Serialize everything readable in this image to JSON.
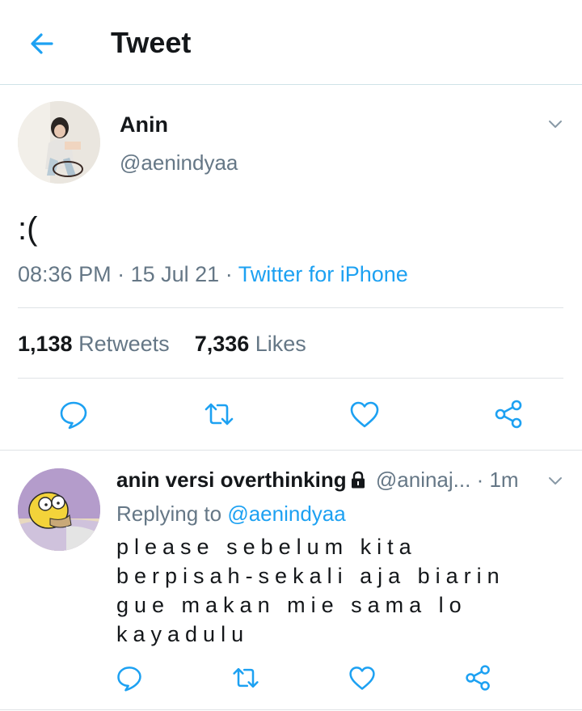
{
  "header": {
    "title": "Tweet",
    "back_icon": "arrow-left-icon"
  },
  "tweet": {
    "author": {
      "name": "Anin",
      "handle": "@aenindyaa"
    },
    "text": ":(",
    "time": "08:36 PM",
    "date": "15 Jul 21",
    "source": "Twitter for iPhone",
    "retweets_count": "1,138",
    "retweets_label": "Retweets",
    "likes_count": "7,336",
    "likes_label": "Likes"
  },
  "reply": {
    "name": "anin versi overthinking",
    "handle": "@aninaj...",
    "time": "· 1m",
    "replying_prefix": "Replying to",
    "replying_to": "@aenindyaa",
    "lines": [
      "please sebelum kita",
      "berpisah-sekali aja biarin",
      "gue makan mie sama lo",
      "kayadulu"
    ]
  },
  "colors": {
    "accent": "#1da1f2",
    "text": "#14171a",
    "muted": "#657786",
    "icon": "#1da1f2"
  },
  "icons": [
    "arrow-left-icon",
    "chevron-down-icon",
    "reply-icon",
    "retweet-icon",
    "like-icon",
    "share-icon",
    "lock-icon"
  ]
}
